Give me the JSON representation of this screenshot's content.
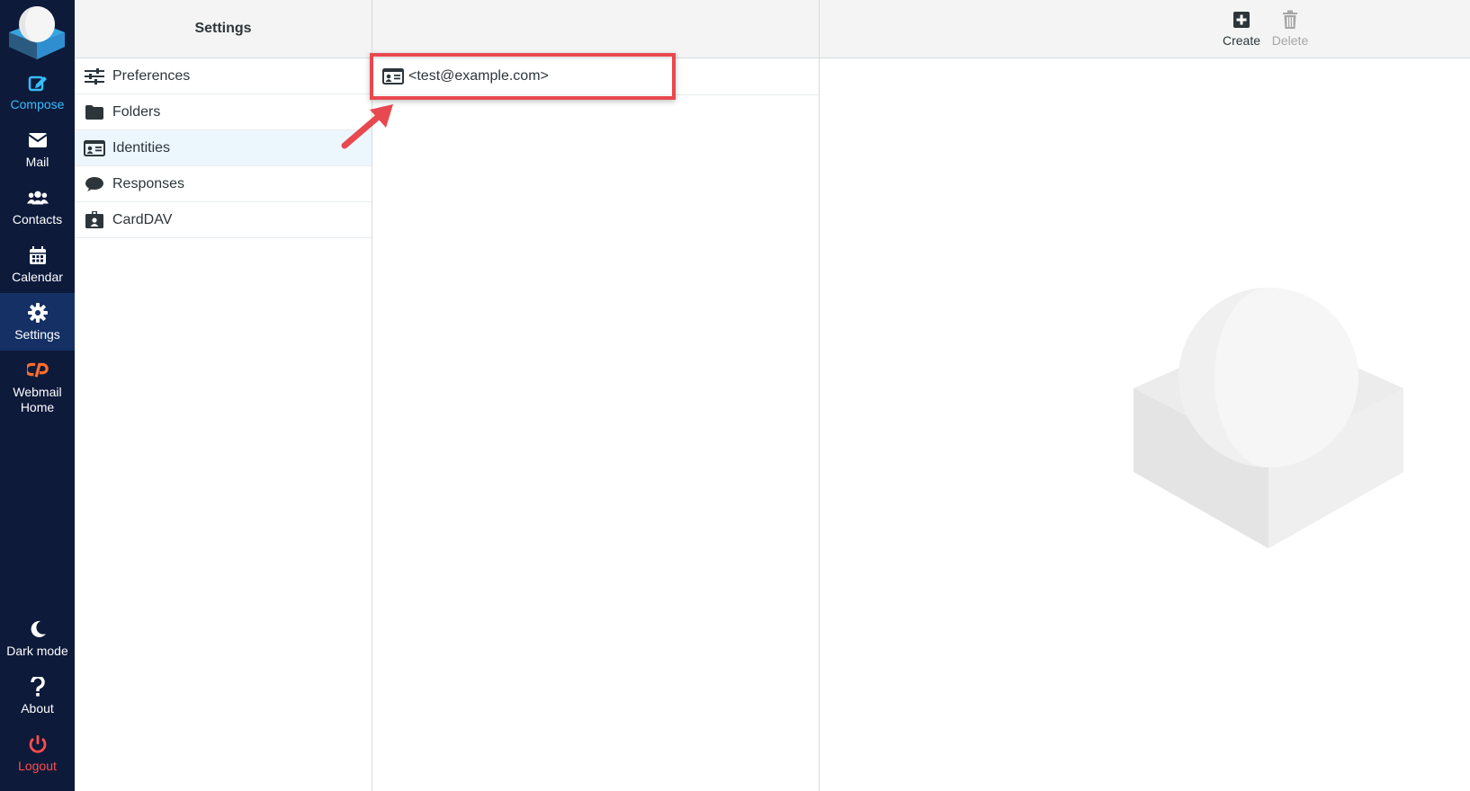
{
  "nav": {
    "compose": "Compose",
    "mail": "Mail",
    "contacts": "Contacts",
    "calendar": "Calendar",
    "settings": "Settings",
    "webmail_home_line1": "Webmail",
    "webmail_home_line2": "Home",
    "dark_mode": "Dark mode",
    "about": "About",
    "logout": "Logout"
  },
  "settings_panel": {
    "title": "Settings",
    "items": [
      {
        "label": "Preferences",
        "icon": "sliders-icon"
      },
      {
        "label": "Folders",
        "icon": "folder-icon"
      },
      {
        "label": "Identities",
        "icon": "id-card-icon",
        "selected": true
      },
      {
        "label": "Responses",
        "icon": "comment-icon"
      },
      {
        "label": "CardDAV",
        "icon": "id-badge-icon"
      }
    ]
  },
  "identities": {
    "rows": [
      {
        "label": "<test@example.com>"
      }
    ]
  },
  "toolbar": {
    "create": "Create",
    "delete": "Delete"
  },
  "colors": {
    "nav_bg": "#0d1a3a",
    "nav_active": "#143064",
    "compose_accent": "#37beff",
    "logout_accent": "#ff4d4d",
    "highlight": "#e8484f",
    "cpanel_orange": "#ff6c2c"
  }
}
